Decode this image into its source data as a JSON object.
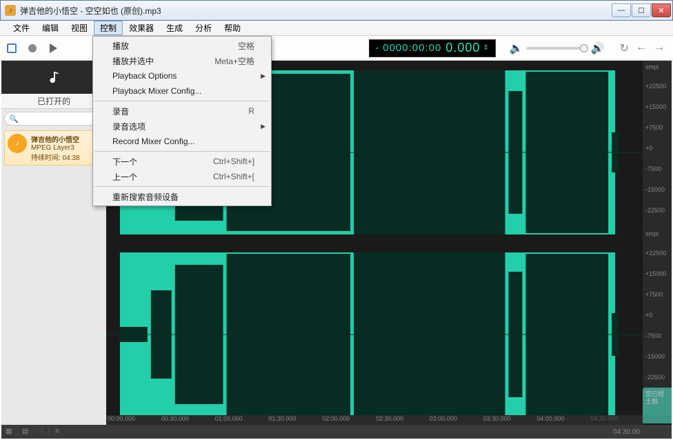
{
  "window": {
    "title": "弹吉他的小悟空 - 空空如也 (原创).mp3"
  },
  "menu": {
    "file": "文件",
    "edit": "编辑",
    "view": "视图",
    "control": "控制",
    "effects": "效果器",
    "generate": "生成",
    "analyze": "分析",
    "help": "帮助"
  },
  "dropdown": {
    "play": "播放",
    "play_sc": "空格",
    "play_sel": "播放并选中",
    "play_sel_sc": "Meta+空格",
    "playback_opts": "Playback Options",
    "playback_mixer": "Playback Mixer Config...",
    "record": "录音",
    "record_sc": "R",
    "record_opts": "录音选项",
    "record_mixer": "Record Mixer Config...",
    "next": "下一个",
    "next_sc": "Ctrl+Shift+]",
    "prev": "上一个",
    "prev_sc": "Ctrl+Shift+[",
    "rescan": "重新搜索音频设备"
  },
  "timecode": {
    "left": "- 0000:00:00",
    "right": "0.000"
  },
  "sidebar": {
    "tab": "已打开的",
    "file": {
      "name": "弹吉他的小悟空",
      "codec": "MPEG Layer3",
      "duration": "持续时间: 04:38"
    }
  },
  "ruler": {
    "smpl": "smpl",
    "p22500": "+22500",
    "p15000": "+15000",
    "p7500": "+7500",
    "zero": "+0",
    "m7500": "-7500",
    "m15000": "-15000",
    "m22500": "-22500"
  },
  "timeline": {
    "t0": "00:00.000",
    "t1": "00:30.000",
    "t2": "01:00.000",
    "t3": "01:30.000",
    "t4": "02:00.000",
    "t5": "02:30.000",
    "t6": "03:00.000",
    "t7": "03:30.000",
    "t8": "04:00.000",
    "t9": "04:30.000"
  },
  "status": {
    "time": "04:30.00"
  },
  "watermark": {
    "line1": "您已经",
    "line2": "土啦"
  }
}
